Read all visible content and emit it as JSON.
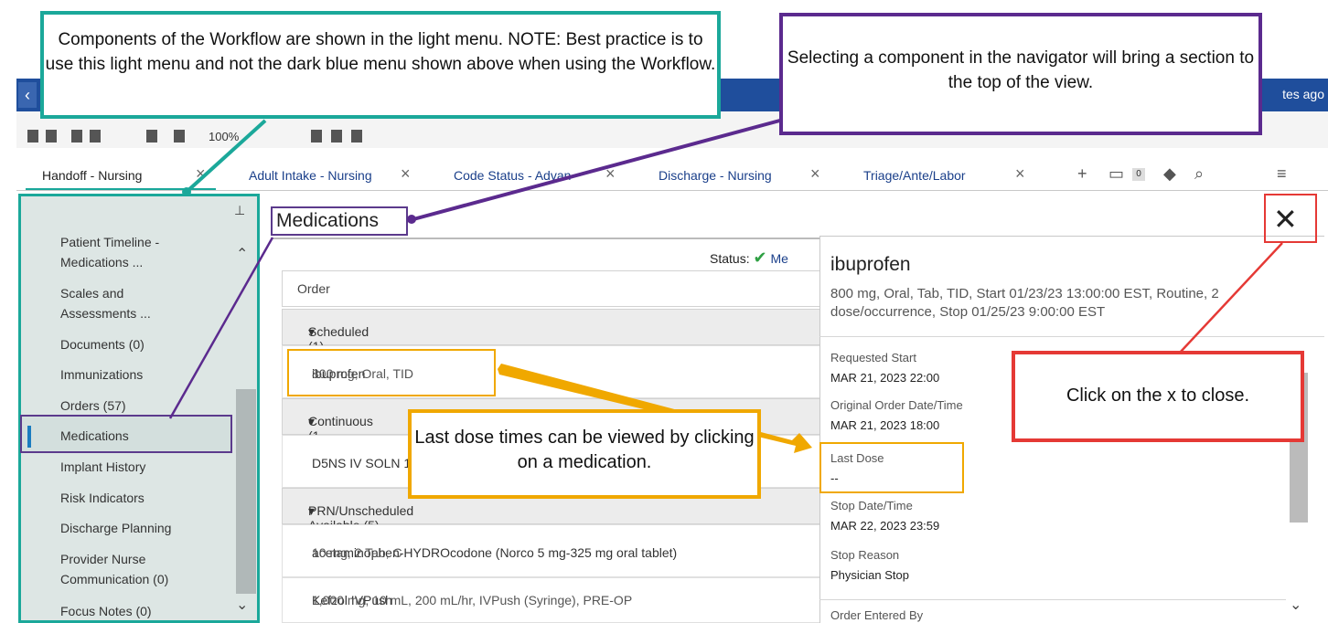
{
  "header": {
    "time_ago": "tes ago"
  },
  "toolbar": {
    "zoom": "100%"
  },
  "tabs": [
    {
      "label": "Handoff - Nursing"
    },
    {
      "label": "Adult Intake - Nursing"
    },
    {
      "label": "Code Status - Advan"
    },
    {
      "label": "Discharge - Nursing"
    },
    {
      "label": "Triage/Ante/Labor"
    }
  ],
  "tab_tools": {
    "plus": "+",
    "badge_count": "0",
    "menu": "≡"
  },
  "navigator": {
    "items": [
      {
        "label": "Patient Timeline -"
      },
      {
        "label": "Medications ..."
      },
      {
        "label": "Scales and"
      },
      {
        "label": "Assessments ..."
      },
      {
        "label": "Documents (0)"
      },
      {
        "label": "Immunizations"
      },
      {
        "label": "Orders (57)"
      },
      {
        "label": "Medications"
      },
      {
        "label": "Implant History"
      },
      {
        "label": "Risk Indicators"
      },
      {
        "label": "Discharge Planning"
      },
      {
        "label": "Provider Nurse"
      },
      {
        "label": "Communication (0)"
      },
      {
        "label": "Focus Notes (0)"
      }
    ],
    "selected": "Medications"
  },
  "main": {
    "title": "Medications",
    "status_label": "Status:",
    "status_value": "Me",
    "column_order": "Order",
    "groups": [
      {
        "label": "Scheduled (1)"
      },
      {
        "label": "Continuous (1"
      },
      {
        "label": "PRN/Unscheduled Available (5)"
      }
    ],
    "rows": [
      {
        "name": "ibuprofen",
        "detail": "800 mg, Oral, TID"
      },
      {
        "name": "D5NS IV SOLN 1",
        "detail": ""
      },
      {
        "name": "acetaminophen-HYDROcodone (Norco 5 mg-325 mg oral tablet)",
        "detail": "10 mg, 2 Tab, C"
      },
      {
        "name": "Kefzol IVPush",
        "detail": "1,000 mg, 10 mL, 200 mL/hr, IVPush (Syringe), PRE-OP"
      }
    ]
  },
  "detail": {
    "close": "✕",
    "med_name": "ibuprofen",
    "sig": "800 mg, Oral, Tab, TID, Start 01/23/23 13:00:00 EST, Routine, 2 dose/occurrence, Stop 01/25/23 9:00:00 EST",
    "fields": [
      {
        "label": "Requested Start",
        "value": "MAR 21, 2023 22:00"
      },
      {
        "label": "Original Order Date/Time",
        "value": "MAR 21, 2023 18:00"
      },
      {
        "label": "Last Dose",
        "value": "--"
      },
      {
        "label": "Stop Date/Time",
        "value": "MAR 22, 2023 23:59"
      },
      {
        "label": "Stop Reason",
        "value": "Physician Stop"
      },
      {
        "label": "Order Entered By",
        "value": ""
      }
    ]
  },
  "callouts": {
    "green": "Components of the Workflow are shown in the light menu. NOTE: Best practice is to use this light menu and not the dark blue menu shown above when using the Workflow.",
    "purple": "Selecting a component in the navigator will bring a section to the top of the view.",
    "orange": "Last dose times can be viewed by clicking on a medication.",
    "red": "Click on the x to close."
  },
  "colors": {
    "green": "#1ba89a",
    "purple": "#5b2a8e",
    "orange": "#f0a800",
    "red": "#e53935",
    "topbar": "#1f4e9c"
  }
}
